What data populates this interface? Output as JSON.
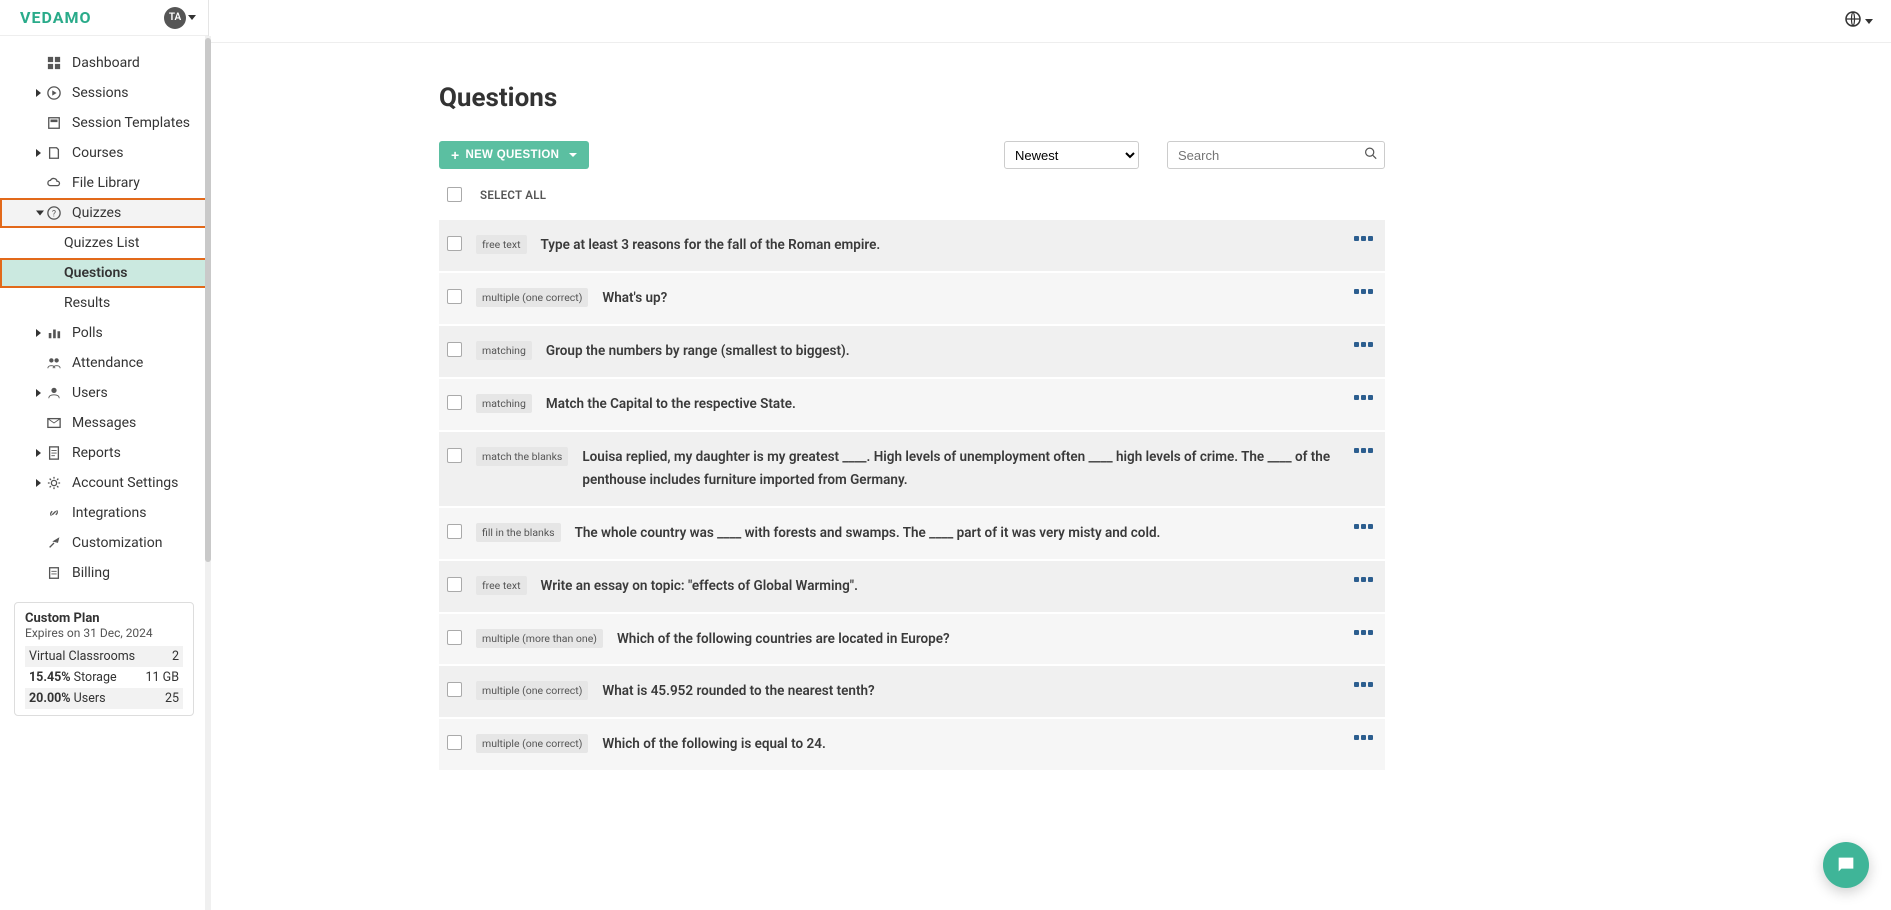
{
  "brand": "VEDAMO",
  "user_initials": "TA",
  "annotations": {
    "quizzes": "1",
    "questions": "2"
  },
  "sidebar": {
    "items": [
      {
        "label": "Dashboard"
      },
      {
        "label": "Sessions"
      },
      {
        "label": "Session Templates"
      },
      {
        "label": "Courses"
      },
      {
        "label": "File Library"
      },
      {
        "label": "Quizzes"
      },
      {
        "label": "Polls"
      },
      {
        "label": "Attendance"
      },
      {
        "label": "Users"
      },
      {
        "label": "Messages"
      },
      {
        "label": "Reports"
      },
      {
        "label": "Account Settings"
      },
      {
        "label": "Integrations"
      },
      {
        "label": "Customization"
      },
      {
        "label": "Billing"
      }
    ],
    "quizzes_children": [
      {
        "label": "Quizzes List"
      },
      {
        "label": "Questions"
      },
      {
        "label": "Results"
      }
    ]
  },
  "plan": {
    "title": "Custom Plan",
    "expires": "Expires on 31 Dec, 2024",
    "rows": [
      {
        "left_strong": "",
        "left": "Virtual Classrooms",
        "right": "2"
      },
      {
        "left_strong": "15.45%",
        "left": "Storage",
        "right": "11 GB"
      },
      {
        "left_strong": "20.00%",
        "left": "Users",
        "right": "25"
      }
    ]
  },
  "page": {
    "title": "Questions",
    "new_button": "NEW QUESTION",
    "sort_selected": "Newest",
    "search_placeholder": "Search",
    "select_all": "SELECT ALL"
  },
  "questions": [
    {
      "type": "free text",
      "text": "Type at least 3 reasons for the fall of the Roman empire."
    },
    {
      "type": "multiple (one correct)",
      "text": "What's up?"
    },
    {
      "type": "matching",
      "text": "Group the numbers by range (smallest to biggest)."
    },
    {
      "type": "matching",
      "text": "Match the Capital to the respective State."
    },
    {
      "type": "match the blanks",
      "text": "Louisa replied, my daughter is my greatest ____. High levels of unemployment often  ____ high levels of crime. The  ____ of the penthouse includes furniture imported from Germany."
    },
    {
      "type": "fill in the blanks",
      "text": "The whole country was ____ with forests and swamps. The  ____ part of it was very misty and cold."
    },
    {
      "type": "free text",
      "text": "Write an essay on topic: \"effects of Global Warming\"."
    },
    {
      "type": "multiple (more than one)",
      "text": "Which of the following countries are located in Europe?"
    },
    {
      "type": "multiple (one correct)",
      "text": "What is 45.952 rounded to the nearest tenth?"
    },
    {
      "type": "multiple (one correct)",
      "text": "Which of the following is equal to 24."
    }
  ]
}
